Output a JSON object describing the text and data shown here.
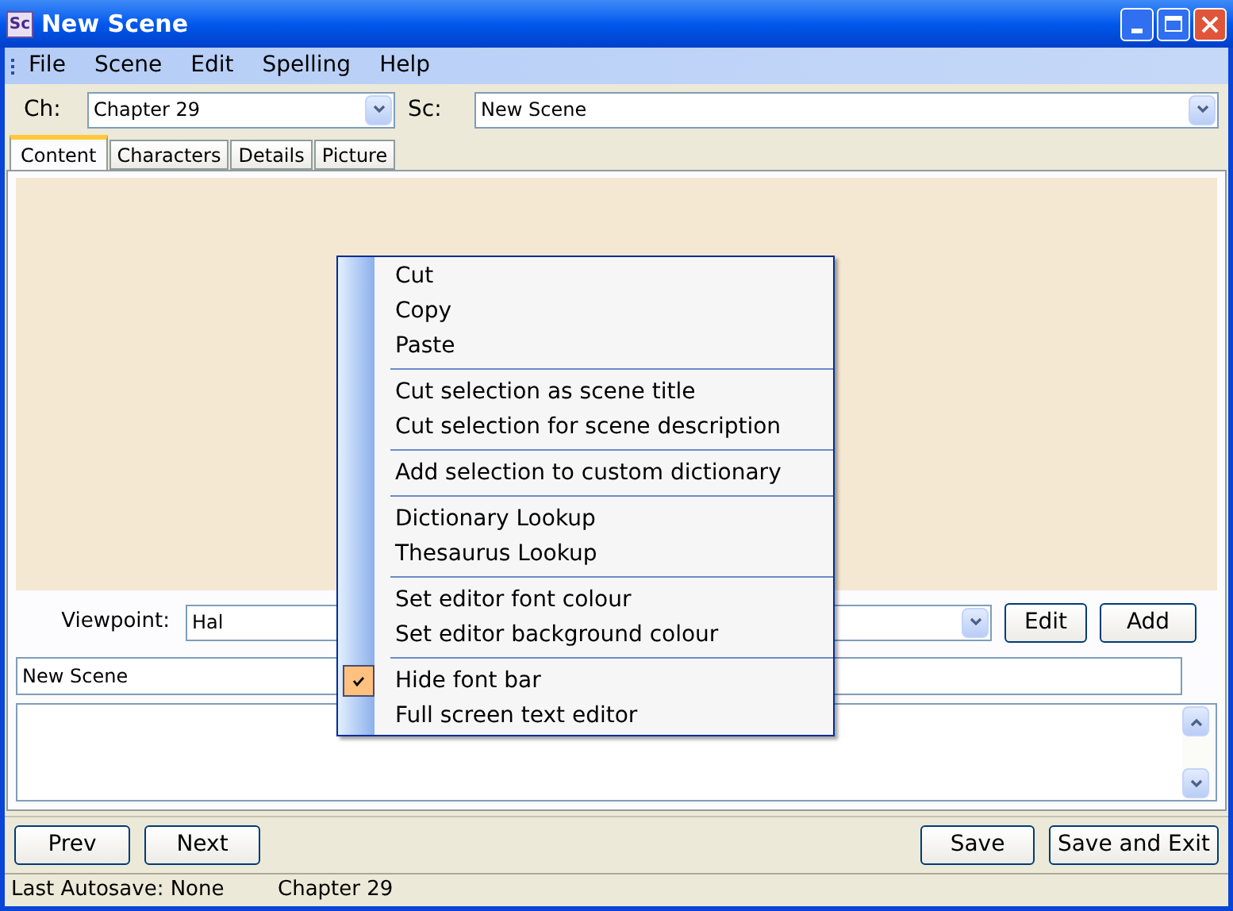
{
  "window": {
    "icon_text": "Sc",
    "title": "New Scene"
  },
  "menu": [
    "File",
    "Scene",
    "Edit",
    "Spelling",
    "Help"
  ],
  "chapter": {
    "label": "Ch:",
    "value": "Chapter 29"
  },
  "scene": {
    "label": "Sc:",
    "value": "New Scene"
  },
  "tabs": [
    {
      "label": "Content",
      "selected": true
    },
    {
      "label": "Characters",
      "selected": false
    },
    {
      "label": "Details",
      "selected": false
    },
    {
      "label": "Picture",
      "selected": false
    }
  ],
  "viewpoint": {
    "label": "Viewpoint:",
    "value": "Hal"
  },
  "viewpoint_buttons": [
    "Edit",
    "Add"
  ],
  "title_field": {
    "value": "New Scene"
  },
  "nav_buttons": [
    "Prev",
    "Next"
  ],
  "action_buttons": [
    "Save",
    "Save and Exit"
  ],
  "status_bar": [
    "Last Autosave: None",
    "Chapter 29"
  ],
  "context_menu": [
    [
      {
        "label": "Cut",
        "checked": false
      },
      {
        "label": "Copy",
        "checked": false
      },
      {
        "label": "Paste",
        "checked": false
      }
    ],
    [
      {
        "label": "Cut selection as scene title",
        "checked": false
      },
      {
        "label": "Cut selection for scene description",
        "checked": false
      }
    ],
    [
      {
        "label": "Add selection to custom dictionary",
        "checked": false
      }
    ],
    [
      {
        "label": "Dictionary Lookup",
        "checked": false
      },
      {
        "label": "Thesaurus Lookup",
        "checked": false
      }
    ],
    [
      {
        "label": "Set editor font colour",
        "checked": false
      },
      {
        "label": "Set editor background colour",
        "checked": false
      }
    ],
    [
      {
        "label": "Hide font bar",
        "checked": true
      },
      {
        "label": "Full screen text editor",
        "checked": false
      }
    ]
  ]
}
